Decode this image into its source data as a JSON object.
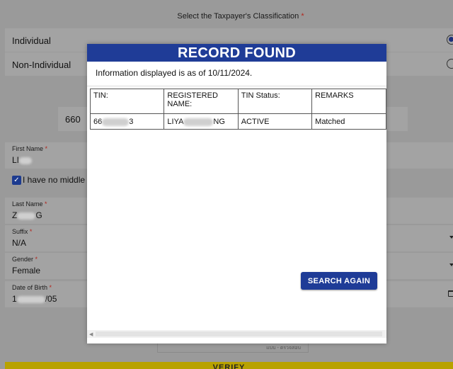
{
  "form": {
    "classification_label": "Select the Taxpayer's Classification",
    "required_mark": "*",
    "options": [
      {
        "label": "Individual",
        "selected": true
      },
      {
        "label": "Non-Individual",
        "selected": false
      }
    ],
    "tin_value": "660",
    "first_name": {
      "label": "First Name",
      "value": "LI"
    },
    "no_middle_name": {
      "label": "I have no middle",
      "checked": true,
      "check_glyph": "✓"
    },
    "last_name": {
      "label": "Last Name",
      "value_prefix": "Z",
      "value_suffix": "G"
    },
    "suffix": {
      "label": "Suffix",
      "value": "N/A"
    },
    "gender": {
      "label": "Gender",
      "value": "Female"
    },
    "dob": {
      "label": "Date of Birth",
      "value_prefix": "1",
      "value_suffix": "/05"
    },
    "captcha_text": "แบบ - ตรวจสอบ",
    "verify_label": "VERIFY"
  },
  "modal": {
    "title": "RECORD FOUND",
    "info_text": "Information displayed is as of 10/11/2024.",
    "headers": [
      "TIN:",
      "REGISTERED NAME:",
      "TIN Status:",
      "REMARKS"
    ],
    "row": {
      "tin_prefix": "66",
      "tin_suffix": "3",
      "name_prefix": "LIYA",
      "name_suffix": "NG",
      "status": "ACTIVE",
      "remarks": "Matched"
    },
    "search_again_label": "SEARCH AGAIN",
    "scroll_arrow": "◀"
  },
  "colors": {
    "modal_header": "#1f3c97",
    "button": "#1f3c97",
    "overlay": "#9a9a9a",
    "verify_bar": "#b8a200"
  }
}
